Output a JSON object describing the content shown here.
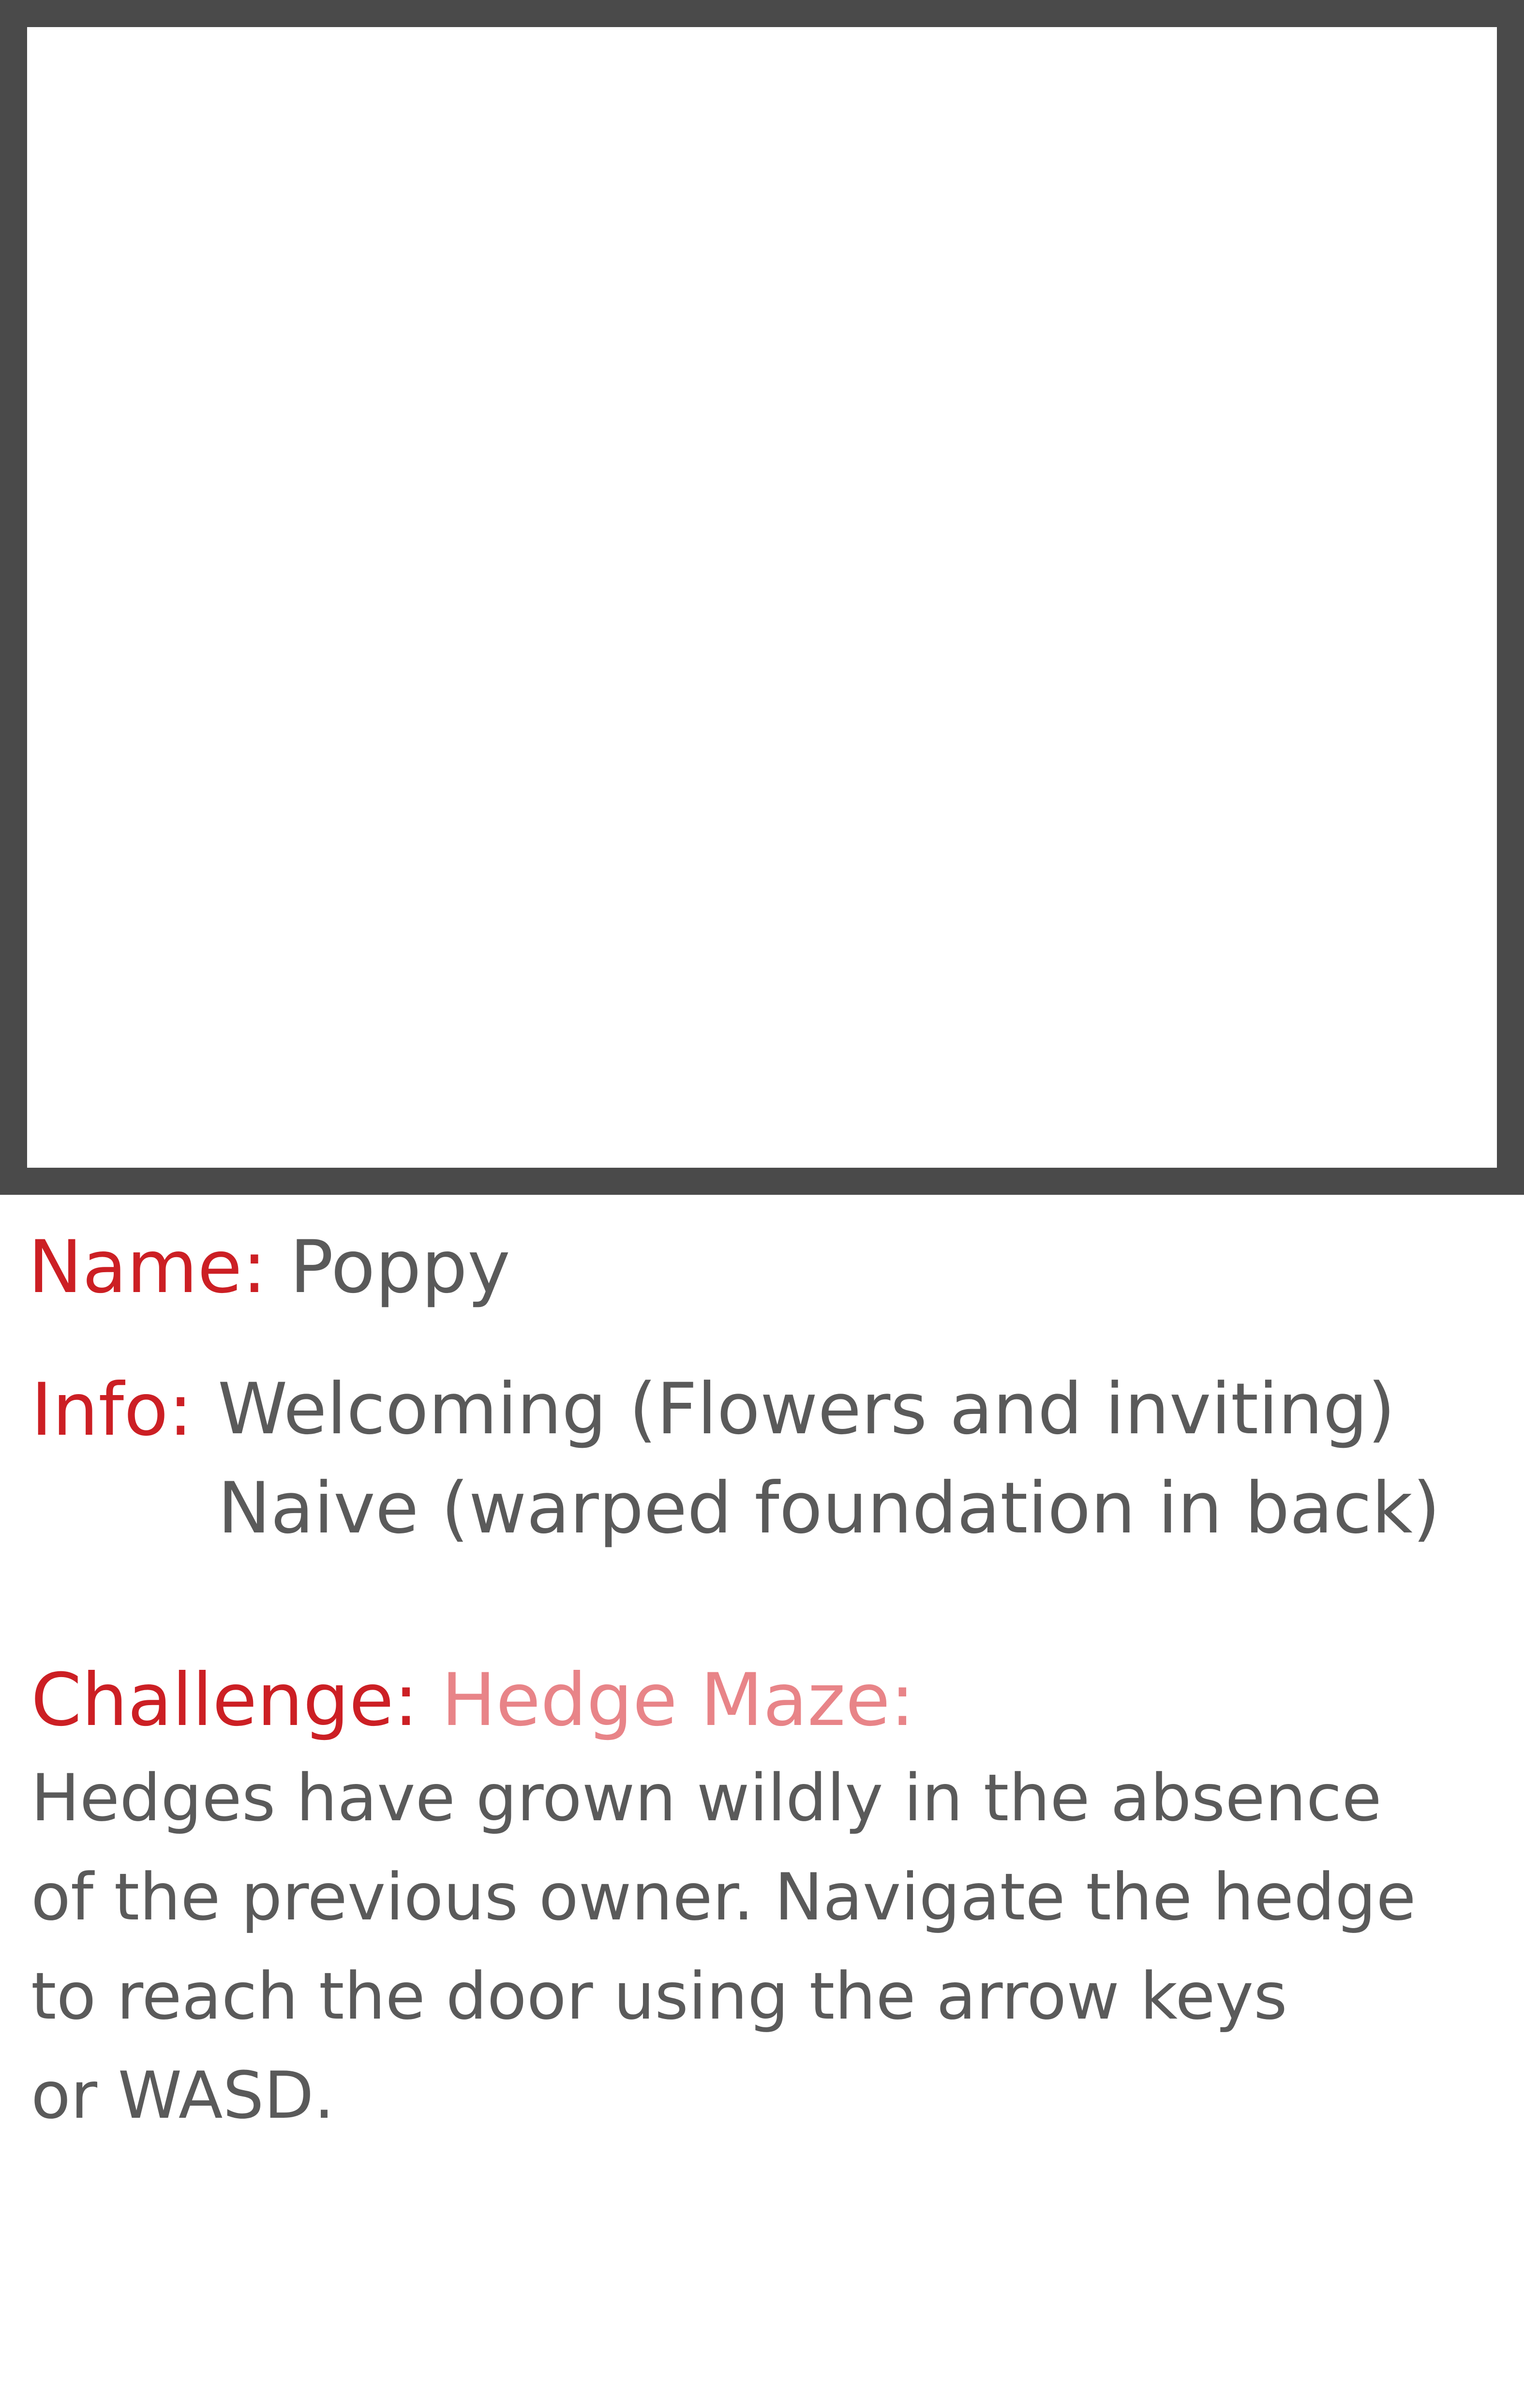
{
  "card": {
    "name_label": "Name:",
    "name_value": "Poppy",
    "info_label": "Info:",
    "info_lines": [
      "Welcoming (Flowers and inviting)",
      "Naive (warped foundation in back)"
    ],
    "challenge_label": "Challenge:",
    "challenge_title": "Hedge Maze:",
    "challenge_lines": [
      "Hedges have grown wildly in the absence",
      "of the previous owner. Navigate the hedge",
      "to reach the door using the arrow keys",
      "or WASD."
    ]
  },
  "colors": {
    "frame_border": "#4a4a4a",
    "label_red": "#cc1f24",
    "title_pink": "#e88488",
    "text_gray": "#5a5a5a"
  }
}
